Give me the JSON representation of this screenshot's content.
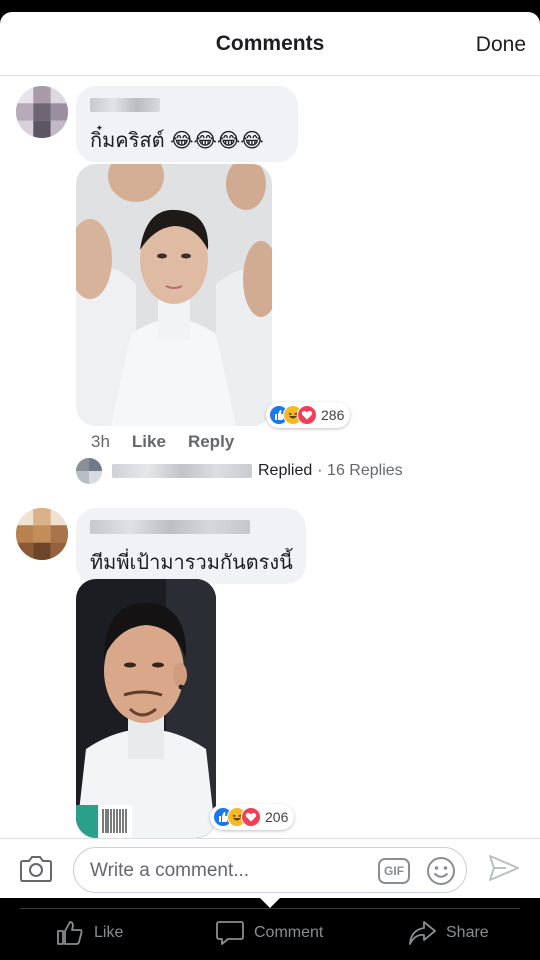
{
  "header": {
    "title": "Comments",
    "done_label": "Done"
  },
  "comments": [
    {
      "text": "กิ๋มคริสต์ 😂😂😂😂",
      "reaction_count": "286",
      "time": "3h",
      "like_label": "Like",
      "reply_label": "Reply",
      "replies_label": "Replied",
      "replies_count": "· 16 Replies"
    },
    {
      "text": "ทีมพี่เป้ามารวมกันตรงนี้",
      "reaction_count": "206"
    }
  ],
  "composer": {
    "placeholder": "Write a comment...",
    "gif_label": "GIF"
  },
  "tabbar": {
    "like": "Like",
    "comment": "Comment",
    "share": "Share"
  },
  "colors": {
    "like_blue": "#3b5998",
    "haha_yellow": "#f7b928",
    "love_red": "#f33e58",
    "bubble_gray": "#f0f2f5"
  },
  "icons": [
    "camera-icon",
    "gif-icon",
    "emoji-icon",
    "send-icon",
    "thumbs-up-icon",
    "comment-icon",
    "share-icon"
  ]
}
